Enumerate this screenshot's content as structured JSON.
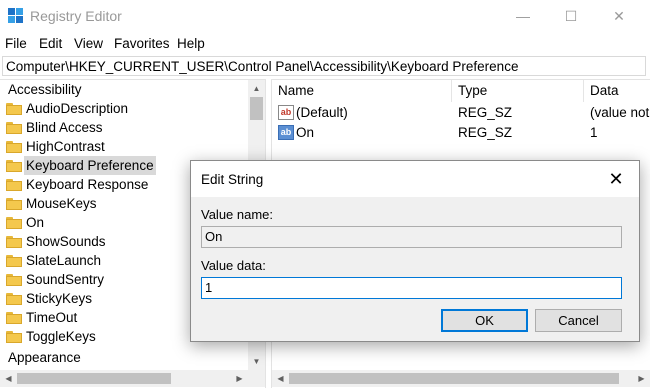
{
  "window": {
    "title": "Registry Editor",
    "minimize_glyph": "—",
    "maximize_glyph": "☐",
    "close_glyph": "✕"
  },
  "menu": [
    "File",
    "Edit",
    "View",
    "Favorites",
    "Help"
  ],
  "address": "Computer\\HKEY_CURRENT_USER\\Control Panel\\Accessibility\\Keyboard Preference",
  "tree": {
    "parent": "Accessibility",
    "children": [
      "AudioDescription",
      "Blind Access",
      "HighContrast",
      "Keyboard Preference",
      "Keyboard Response",
      "MouseKeys",
      "On",
      "ShowSounds",
      "SlateLaunch",
      "SoundSentry",
      "StickyKeys",
      "TimeOut",
      "ToggleKeys"
    ],
    "selected": "Keyboard Preference",
    "next_sibling": "Appearance"
  },
  "list": {
    "columns": [
      "Name",
      "Type",
      "Data"
    ],
    "rows": [
      {
        "name": "(Default)",
        "type": "REG_SZ",
        "data": "(value not",
        "icon": "string-value-icon"
      },
      {
        "name": "On",
        "type": "REG_SZ",
        "data": "1",
        "icon": "string-value-icon-selected"
      }
    ]
  },
  "dialog": {
    "title": "Edit String",
    "close_glyph": "✕",
    "value_name_label": "Value name:",
    "value_name": "On",
    "value_data_label": "Value data:",
    "value_data": "1",
    "ok_label": "OK",
    "cancel_label": "Cancel"
  },
  "icon_text": "ab",
  "colors": {
    "accent": "#0078d7",
    "folder": "#f4c84d",
    "selection": "#d9d9d9"
  }
}
